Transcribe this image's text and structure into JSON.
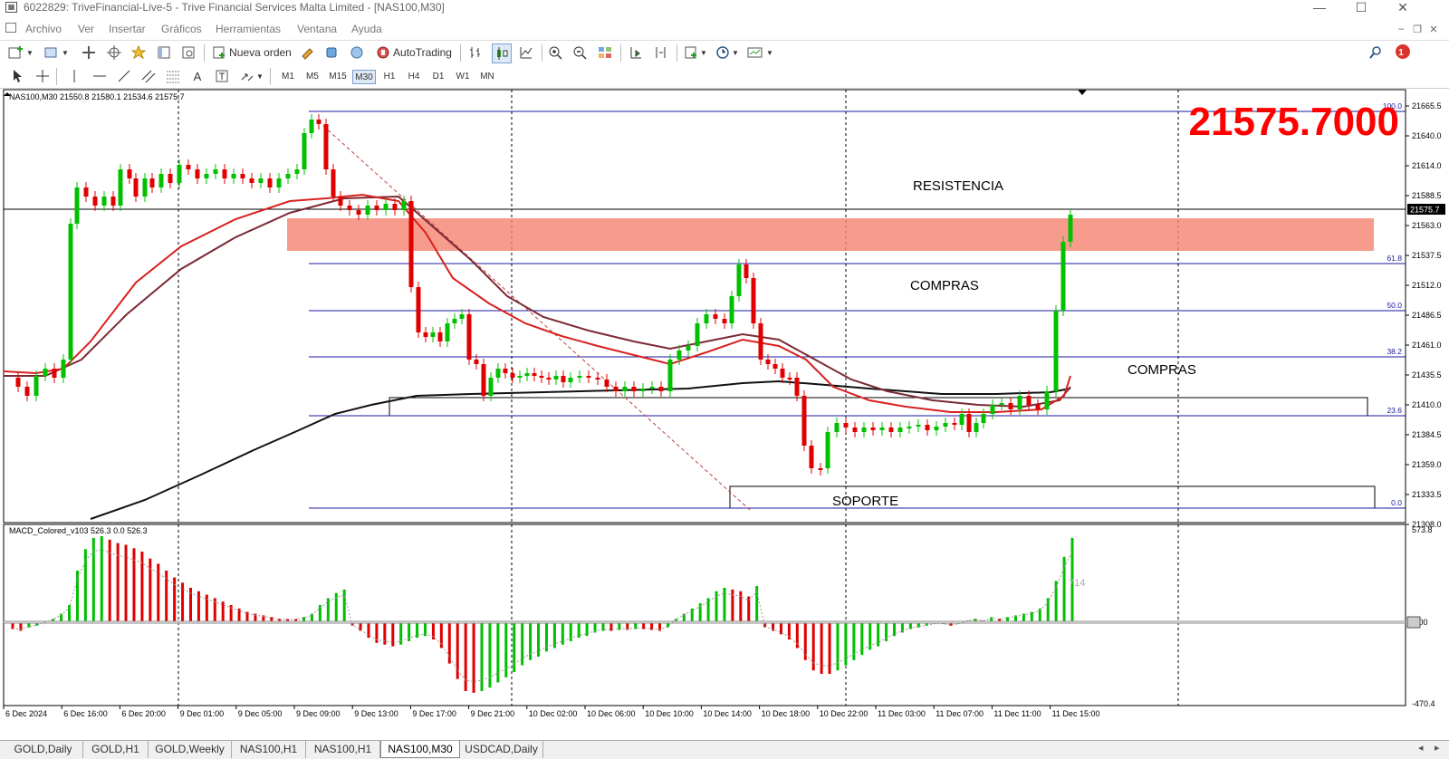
{
  "window": {
    "title": "6022829: TriveFinancial-Live-5 - Trive Financial Services Malta Limited - [NAS100,M30]"
  },
  "menu": [
    "Archivo",
    "Ver",
    "Insertar",
    "Gráficos",
    "Herramientas",
    "Ventana",
    "Ayuda"
  ],
  "toolbar": {
    "new_order": "Nueva orden",
    "autotrading": "AutoTrading",
    "notification_count": "1"
  },
  "timeframes": [
    "M1",
    "M5",
    "M15",
    "M30",
    "H1",
    "H4",
    "D1",
    "W1",
    "MN"
  ],
  "active_timeframe": "M30",
  "main_chart": {
    "info": "NAS100,M30  21550.8 21580.1 21534.6 21575.7",
    "big_price": "21575.7000",
    "current_price_label": "21575.7",
    "price_ticks": [
      "21665.5",
      "21640.0",
      "21614.0",
      "21588.5",
      "21563.0",
      "21537.5",
      "21512.0",
      "21486.5",
      "21461.0",
      "21435.5",
      "21410.0",
      "21384.5",
      "21359.0",
      "21333.5",
      "21308.0"
    ],
    "fib_labels": [
      "100.0",
      "61.8",
      "50.0",
      "38.2",
      "23.6",
      "0.0"
    ],
    "annotations": {
      "resistance": "RESISTENCIA",
      "buys_1": "COMPRAS",
      "buys_2": "COMPRAS",
      "support": "SOPORTE"
    }
  },
  "macd": {
    "info": "MACD_Colored_v103 526.3 0.0 526.3",
    "ticks": [
      "573.8",
      "0.00",
      "-470.4"
    ],
    "value_label": "714"
  },
  "time_axis": [
    "6 Dec 2024",
    "6 Dec 16:00",
    "6 Dec 20:00",
    "9 Dec 01:00",
    "9 Dec 05:00",
    "9 Dec 09:00",
    "9 Dec 13:00",
    "9 Dec 17:00",
    "9 Dec 21:00",
    "10 Dec 02:00",
    "10 Dec 06:00",
    "10 Dec 10:00",
    "10 Dec 14:00",
    "10 Dec 18:00",
    "10 Dec 22:00",
    "11 Dec 03:00",
    "11 Dec 07:00",
    "11 Dec 11:00",
    "11 Dec 15:00"
  ],
  "tabs": [
    "GOLD,Daily",
    "GOLD,H1",
    "GOLD,Weekly",
    "NAS100,H1",
    "NAS100,H1",
    "NAS100,M30",
    "USDCAD,Daily"
  ],
  "active_tab": 5,
  "colors": {
    "bull": "#00c000",
    "bear": "#e00000",
    "zone": "#f5836f",
    "big_price": "#ff0000",
    "fib": "#1a1aa0"
  }
}
